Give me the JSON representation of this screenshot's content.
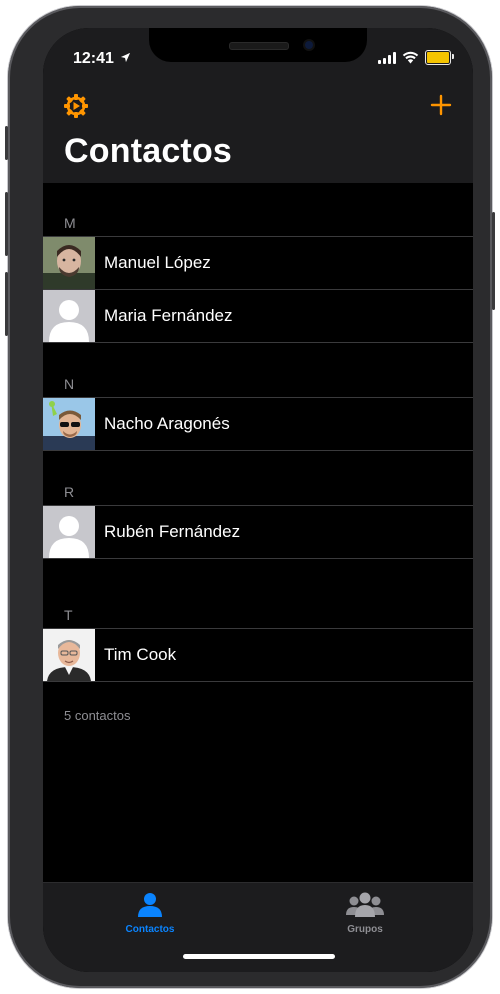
{
  "status_bar": {
    "time": "12:41"
  },
  "header": {
    "title": "Contactos"
  },
  "sections": [
    {
      "letter": "M",
      "contacts": [
        {
          "name": "Manuel López",
          "photo": "photo-man-beard"
        },
        {
          "name": "Maria Fernández",
          "photo": "default-avatar"
        }
      ]
    },
    {
      "letter": "N",
      "contacts": [
        {
          "name": "Nacho Aragonés",
          "photo": "photo-man-sunglasses"
        }
      ]
    },
    {
      "letter": "R",
      "contacts": [
        {
          "name": "Rubén Fernández",
          "photo": "default-avatar"
        }
      ]
    },
    {
      "letter": "T",
      "contacts": [
        {
          "name": "Tim Cook",
          "photo": "photo-man-gray-hair"
        }
      ]
    }
  ],
  "footer": {
    "count_text": "5 contactos"
  },
  "tabbar": {
    "tabs": [
      {
        "label": "Contactos",
        "icon": "person-icon",
        "active": true
      },
      {
        "label": "Grupos",
        "icon": "group-icon",
        "active": false
      }
    ]
  },
  "colors": {
    "accent": "#ff9500",
    "active_tab": "#0a84ff",
    "inactive_tab": "#8e8e93",
    "background": "#000000",
    "header_bg": "#1c1c1e",
    "separator": "#3a3a3c"
  }
}
